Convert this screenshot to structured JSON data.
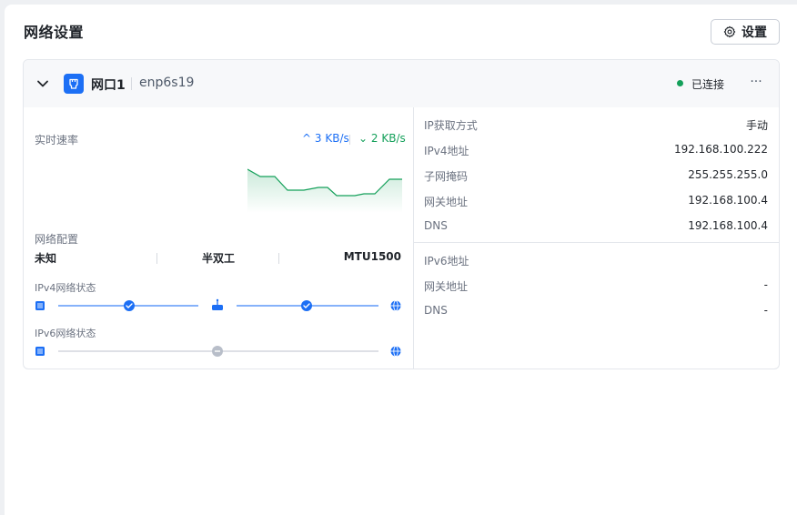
{
  "page": {
    "title": "网络设置",
    "settings_label": "设置"
  },
  "port": {
    "name": "网口1",
    "device": "enp6s19",
    "status": "已连接",
    "status_color": "#14a05a",
    "more_label": "···"
  },
  "rate": {
    "label": "实时速率",
    "up": "3 KB/s",
    "down": "2 KB/s",
    "series": [
      44,
      52,
      52,
      67,
      67,
      64,
      64,
      73,
      73,
      71,
      71,
      55,
      55
    ]
  },
  "netcfg": {
    "label": "网络配置",
    "speed": "未知",
    "duplex": "半双工",
    "mtu": "MTU1500"
  },
  "ipv4_status": {
    "label": "IPv4网络状态"
  },
  "ipv6_status": {
    "label": "IPv6网络状态"
  },
  "ipv4": {
    "method_label": "IP获取方式",
    "method": "手动",
    "address_label": "IPv4地址",
    "address": "192.168.100.222",
    "mask_label": "子网掩码",
    "mask": "255.255.255.0",
    "gateway_label": "网关地址",
    "gateway": "192.168.100.4",
    "dns_label": "DNS",
    "dns": "192.168.100.4"
  },
  "ipv6": {
    "address_label": "IPv6地址",
    "address": "",
    "gateway_label": "网关地址",
    "gateway": "-",
    "dns_label": "DNS",
    "dns": "-"
  },
  "colors": {
    "accent": "#1c6ff5",
    "success": "#14a05a",
    "muted_line": "#c9ced6"
  }
}
